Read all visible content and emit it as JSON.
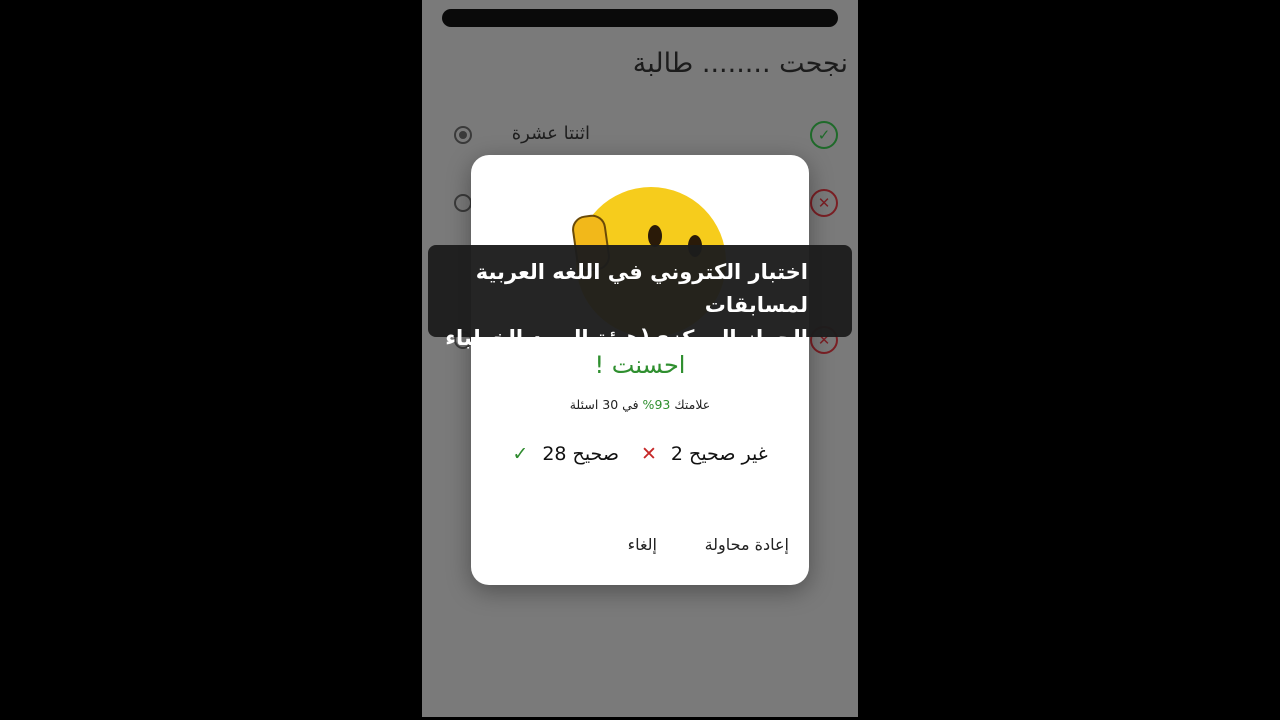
{
  "question": "نجحت ........ طالبة",
  "options": [
    {
      "label": "اثنتا عشرة",
      "selected": true,
      "status": "correct"
    },
    {
      "label": "",
      "selected": false,
      "status": "wrong"
    },
    {
      "label": "",
      "selected": false,
      "status": "wrong"
    }
  ],
  "dialog": {
    "title": "احسنت !",
    "score_prefix": "علامتك",
    "score_percent": "93%",
    "score_suffix": "في 30 اسئلة",
    "wrong_label": "غير صحيح 2",
    "right_label": "صحيح 28",
    "retry_label": "إعادة محاولة",
    "cancel_label": "إلغاء"
  },
  "caption": {
    "line1": "اختبار الكتروني في اللغه العربية لمسابقات",
    "line2": "الجهاز المركزي(هيئة البريد-الخطباء )"
  },
  "colors": {
    "success": "#2f8f2f",
    "error": "#c62828",
    "overlay": "#7a7a7a"
  },
  "icons": {
    "correct": "check-circle-icon",
    "wrong": "x-circle-icon",
    "emoji": "thinking-emoji-icon"
  }
}
